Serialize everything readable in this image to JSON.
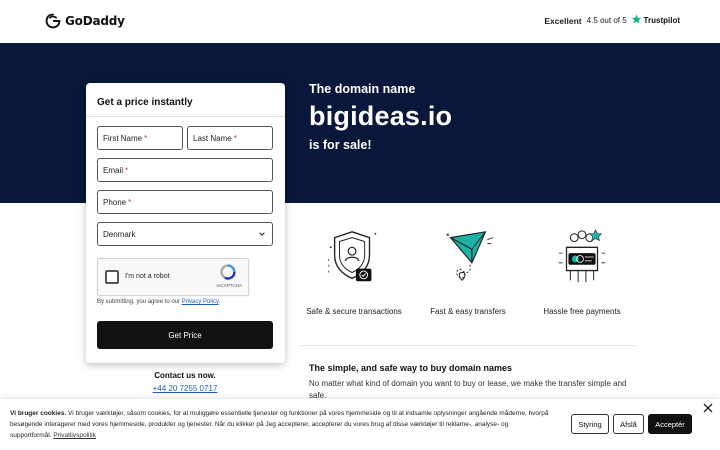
{
  "header": {
    "logo_text": "GoDaddy",
    "rating_word": "Excellent",
    "rating_value": "4.5 out of 5",
    "trustpilot": "Trustpilot"
  },
  "hero": {
    "line1": "The domain name",
    "domain": "bigideas.io",
    "line3": "is for sale!"
  },
  "form": {
    "title": "Get a price instantly",
    "first_name": "First Name",
    "last_name": "Last Name",
    "email": "Email",
    "phone": "Phone",
    "required_mark": "*",
    "country": "Denmark",
    "captcha_label": "I'm not a robot",
    "captcha_brand": "reCAPTCHA",
    "consent_text": "By submitting, you agree to our ",
    "consent_link": "Privacy Policy",
    "consent_end": ".",
    "submit": "Get Price"
  },
  "contact": {
    "title": "Contact us now.",
    "phone": "+44 20 7255 0717"
  },
  "features": [
    {
      "label": "Safe & secure transactions",
      "icon": "shield-icon"
    },
    {
      "label": "Fast & easy transfers",
      "icon": "paper-plane-icon"
    },
    {
      "label": "Hassle free payments",
      "icon": "payment-card-icon"
    }
  ],
  "info": {
    "title": "The simple, and safe way to buy domain names",
    "text": "No matter what kind of domain you want to buy or lease, we make the transfer simple and safe."
  },
  "cookie": {
    "title": "Vi bruger cookies.",
    "text": " Vi bruger værktøjer, såsom cookies, for at muliggøre essentielle tjenester og funktioner på vores hjemmeside og til at indsamle oplysninger angående måderne, hvorpå besøgende interagerer med vores hjemmeside, produkter og tjenester. Når du klikker på Jeg accepterer, accepterer du vores brug af disse værktøjer til reklame-, analyse- og supportformål. ",
    "link": "Privatlivspolitik",
    "btn_manage": "Styring",
    "btn_decline": "Afslå",
    "btn_accept": "Acceptér"
  },
  "colors": {
    "hero_bg": "#09173a",
    "trustpilot_green": "#00b67a",
    "link_blue": "#1b5fc1",
    "teal_accent": "#1bb3a6"
  }
}
